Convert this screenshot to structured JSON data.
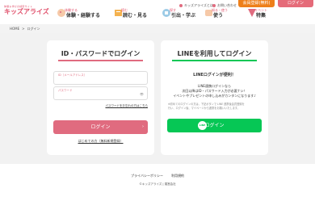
{
  "header": {
    "logo_sub": "体験＆学びの検索サイト",
    "logo_main": "キッズアライズ",
    "nav": [
      {
        "sub": "体験する",
        "main": "体験・経験する",
        "icon": "experience-icon"
      },
      {
        "sub": "読む",
        "main": "読む・見る",
        "icon": "book-icon"
      },
      {
        "sub": "探す",
        "main": "引出・学ぶ",
        "icon": "learn-icon"
      },
      {
        "sub": "知る・使う",
        "main": "使う",
        "icon": "use-icon"
      },
      {
        "sub": "イベント",
        "main": "特集",
        "icon": "feature-icon"
      }
    ],
    "top_links": [
      "キッズアライズとは",
      "お問い合わせ"
    ],
    "register_label": "会員登録(無料)",
    "login_label": "ログイン",
    "accent": "#e06b7f",
    "register_color": "#ee7f1a"
  },
  "breadcrumb": [
    "HOME",
    ">",
    "ログイン"
  ],
  "login_panel": {
    "title": "ID・パスワードでログイン",
    "id_label": "ID（メールアドレス）",
    "pw_label": "パスワード",
    "forgot": "パスワードをお忘れの方はこちら",
    "button": "ログイン",
    "first_time": "はじめての方（無料新規登録）"
  },
  "line_panel": {
    "title": "LINEを利用してログイン",
    "convenient": "LINEログインが便利！",
    "desc": [
      "LINE連携ログインなら",
      "次回以降はID・パスワード入力が必要ナシ！",
      "イベントやプレゼントの申し込みがカンタンになります♪"
    ],
    "note": [
      "※初めてのログインの方は、下記ボタンで LINE 連携後会員登録を",
      "行い、ログイン後、マイページから連携をお願いいたします。"
    ],
    "button": "ログイン",
    "line_icon_text": "LINE",
    "accent": "#06c755"
  },
  "footer": {
    "links": [
      "プライバシーポリシー",
      "利用規約"
    ],
    "copyright": "©キッズアライズ | 運営会社"
  }
}
